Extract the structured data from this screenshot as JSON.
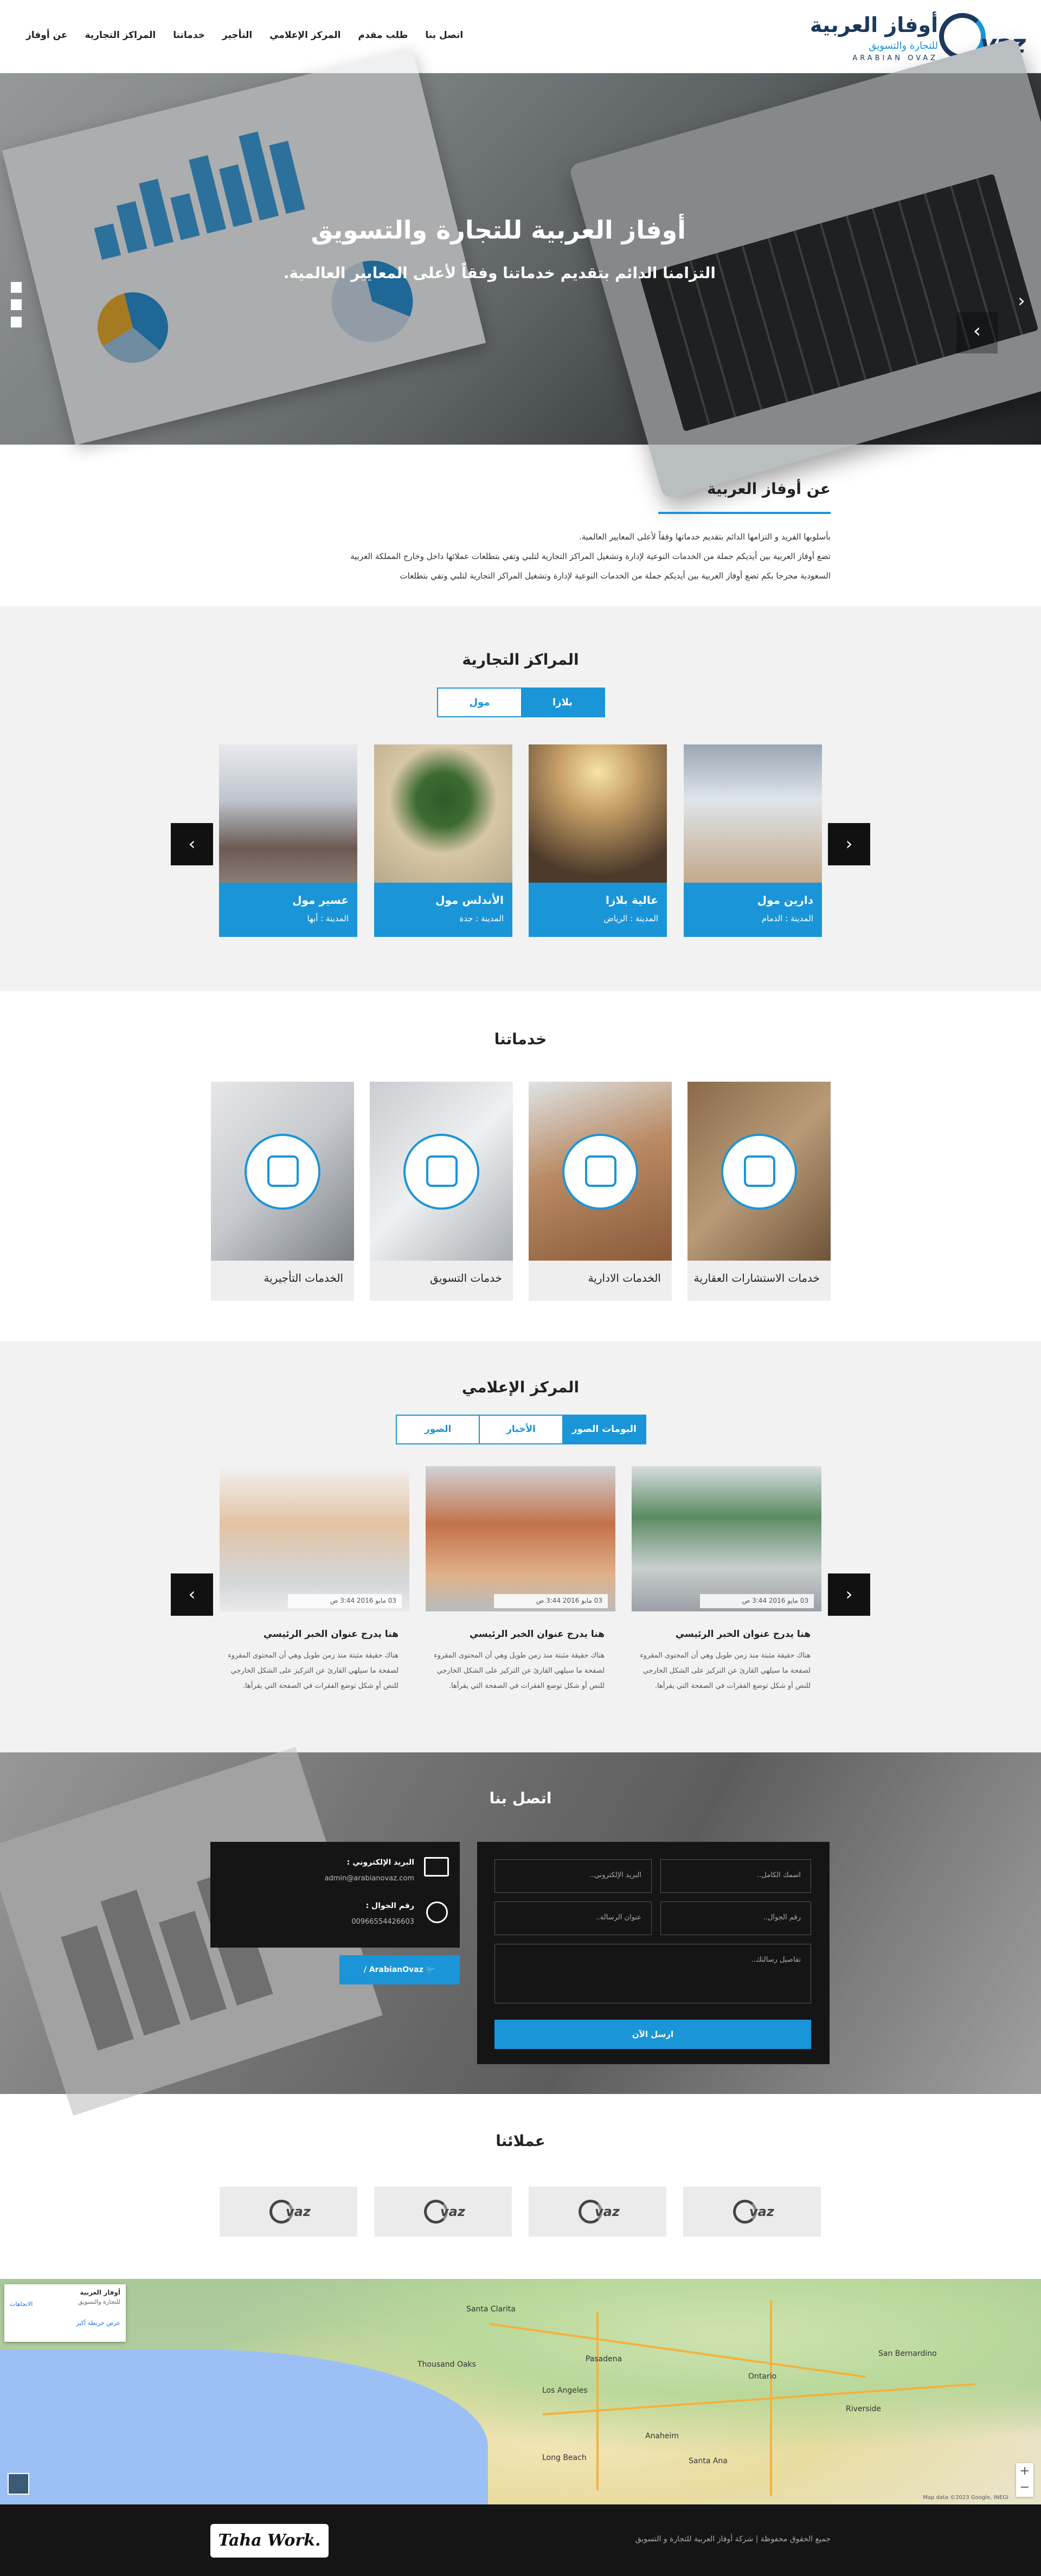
{
  "header": {
    "nav": [
      "عن أوفاز",
      "المراكز التجارية",
      "خدماتنا",
      "التأجير",
      "المركز الإعلامي",
      "طلب مقدم",
      "اتصل بنا"
    ],
    "logo": {
      "ar_title": "أوفاز العربية",
      "ar_sub": "للتجارة والتسويق",
      "en_sub": "ARABIAN OVAZ",
      "mark": "vaz"
    }
  },
  "hero": {
    "title": "أوفاز العربية للتجارة والتسويق",
    "subtitle": "التزامنا الدائم بتقديم خدماتنا وفقاً لأعلى المعايير العالمية.",
    "next_icon": "chevron-right-icon",
    "prev_icon": "chevron-left-icon"
  },
  "about": {
    "title": "عن أوفاز العربية",
    "lines": [
      "بأسلوبها الفريد و التزامها الدائم بتقديم خدماتها وفقاً لأعلى المعايير العالمية.",
      "تضع أوفاز العربية بين أيديكم جملة من الخدمات النوعية لإدارة وتشغيل المراكز التجارية لتلبي وتفي بتطلعات عملائها داخل وخارج المملكة العربية",
      "السعودية مجرجا بكم تضع أوفاز العربية بين أيديكم جملة من الخدمات النوعية لإدارة وتشغيل المراكز التجارية لتلبي وتفي بتطلعات"
    ]
  },
  "centers": {
    "title": "المراكز التجارية",
    "tabs": [
      "بلازا",
      "مول"
    ],
    "active_tab": "بلازا",
    "cards": [
      {
        "name": "دارين مول",
        "city": "المدينة : الدمام"
      },
      {
        "name": "عالية بلازا",
        "city": "المدينة : الرياض"
      },
      {
        "name": "الأندلس مول",
        "city": "المدينة : جدة"
      },
      {
        "name": "عسير مول",
        "city": "المدينة : أبها"
      }
    ]
  },
  "services": {
    "title": "خدماتنا",
    "items": [
      {
        "label": "خدمات الاستشارات العقارية",
        "icon": "consulting-icon"
      },
      {
        "label": "الخدمات الادارية",
        "icon": "handshake-house-icon"
      },
      {
        "label": "خدمات التسويق",
        "icon": "marketing-chart-icon"
      },
      {
        "label": "الخدمات التأجيرية",
        "icon": "rental-house-icon"
      }
    ]
  },
  "media": {
    "title": "المركز الإعلامي",
    "tabs": [
      "البومات الصور",
      "الأخبار",
      "الصور"
    ],
    "active_tab": "البومات الصور",
    "news": [
      {
        "date": "03 مايو 2016 3:44 ص",
        "title": "هنا يدرج عنوان الخبر الرئيسي",
        "body": "هناك حقيقة مثبتة منذ زمن طويل وهي أن المحتوى المقروء لصفحة ما سيلهي القارئ عن التركيز على الشكل الخارجي للنص أو شكل توضع الفقرات في الصفحة التي يقرأها."
      },
      {
        "date": "03 مايو 2016 3:44 ص",
        "title": "هنا يدرج عنوان الخبر الرئيسي",
        "body": "هناك حقيقة مثبتة منذ زمن طويل وهي أن المحتوى المقروء لصفحة ما سيلهي القارئ عن التركيز على الشكل الخارجي للنص أو شكل توضع الفقرات في الصفحة التي يقرأها."
      },
      {
        "date": "03 مايو 2016 3:44 ص",
        "title": "هنا يدرج عنوان الخبر الرئيسي",
        "body": "هناك حقيقة مثبتة منذ زمن طويل وهي أن المحتوى المقروء لصفحة ما سيلهي القارئ عن التركيز على الشكل الخارجي للنص أو شكل توضع الفقرات في الصفحة التي يقرأها."
      }
    ]
  },
  "contact": {
    "title": "اتصل بنا",
    "form": {
      "name_ph": "اسمك الكامل..",
      "email_ph": "البريد الإلكتروني..",
      "phone_ph": "رقم الجوال..",
      "subject_ph": "عنوان الرسالة..",
      "message_ph": "تفاصيل رسالتك..",
      "send": "ارسل الآن"
    },
    "info": {
      "email_label": "البريد الإلكتروني :",
      "email": "admin@arabianovaz.com",
      "phone_label": "رقم الجوال :",
      "phone": "00966554426603",
      "twitter": "ArabianOvaz /"
    }
  },
  "clients": {
    "title": "عملائنا",
    "logos": [
      "vaz",
      "vaz",
      "vaz",
      "vaz"
    ]
  },
  "map": {
    "card_title": "أوفاز العربية",
    "card_sub": "للتجارة والتسويق",
    "card_link": "عرض خريطة أكبر",
    "directions": "الاتجاهات",
    "places": [
      "Santa Clarita",
      "San Bernardino",
      "Thousand Oaks",
      "Los Angeles",
      "Riverside",
      "Anaheim",
      "Long Beach",
      "Santa Ana",
      "Pasadena",
      "Ontario"
    ],
    "credits": "Map data ©2023 Google, INEGI"
  },
  "footer": {
    "brand": "Taha Work.",
    "copyright": "جميع الحقوق محفوظة | شركة أوفاز العربية للتجارة و التسويق"
  }
}
